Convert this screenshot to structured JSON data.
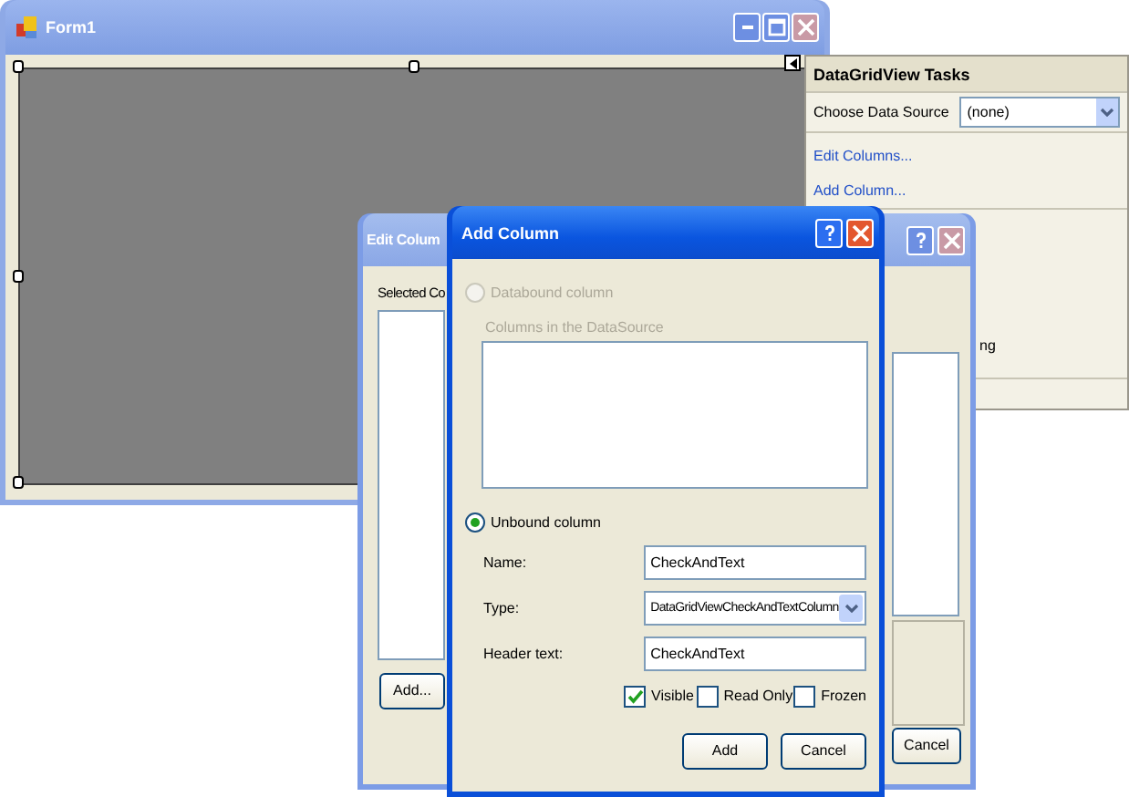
{
  "form_window": {
    "title": "Form1"
  },
  "tasks_panel": {
    "title": "DataGridView Tasks",
    "data_source_label": "Choose Data Source",
    "data_source_value": "(none)",
    "links": [
      "Edit Columns...",
      "Add Column..."
    ],
    "partial_item": "ng"
  },
  "edit_columns_dialog": {
    "title": "Edit Colum",
    "selected_columns_label": "Selected Co",
    "buttons": [
      "Add...",
      "Cancel"
    ]
  },
  "add_column_dialog": {
    "title": "Add Column",
    "databound_option": {
      "label": "Databound column",
      "selected": false,
      "disabled": true
    },
    "columns_label": "Columns in the DataSource",
    "unbound_option": {
      "label": "Unbound column",
      "selected": true,
      "disabled": false
    },
    "fields": [
      {
        "kind": "text",
        "label": "Name:",
        "value": "CheckAndText"
      },
      {
        "kind": "dropdown",
        "label": "Type:",
        "value": "DataGridViewCheckAndTextColumn"
      },
      {
        "kind": "text",
        "label": "Header text:",
        "value": "CheckAndText"
      }
    ],
    "options": [
      {
        "label": "Visible",
        "checked": true
      },
      {
        "label": "Read Only",
        "checked": false
      },
      {
        "label": "Frozen",
        "checked": false
      }
    ],
    "buttons": [
      "Add",
      "Cancel"
    ]
  }
}
